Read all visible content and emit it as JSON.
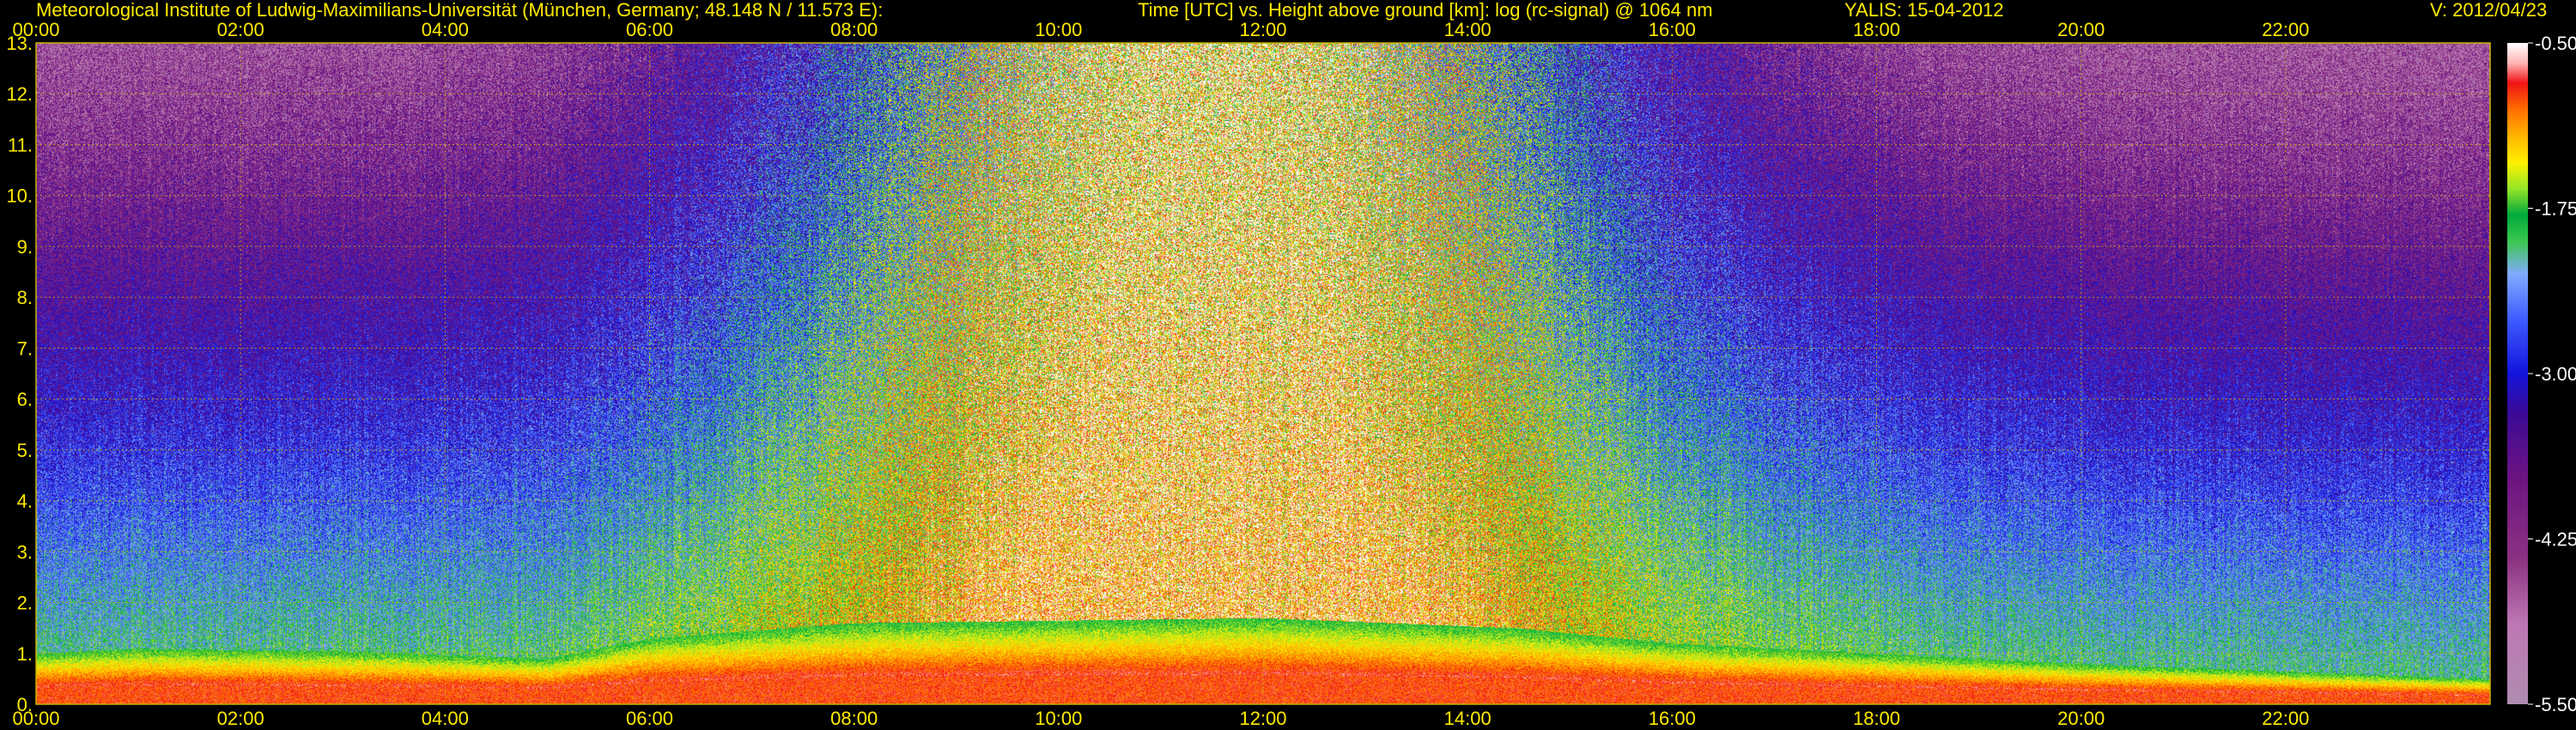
{
  "header": {
    "left": "Meteorological Institute of Ludwig-Maximilians-Universität (München, Germany; 48.148 N / 11.573 E):",
    "center": "Time [UTC] vs. Height above ground [km]: log (rc-signal) @ 1064 nm",
    "station": "YALIS: 15-04-2012",
    "version": "V: 2012/04/23"
  },
  "chart_data": {
    "type": "heatmap",
    "title": "Time [UTC] vs. Height above ground [km]: log (rc-signal) @ 1064 nm",
    "xlabel": "Time [UTC]",
    "ylabel": "Height above ground [km]",
    "x_ticks": [
      "00:00",
      "02:00",
      "04:00",
      "06:00",
      "08:00",
      "10:00",
      "12:00",
      "14:00",
      "16:00",
      "18:00",
      "20:00",
      "22:00"
    ],
    "x_tick_hours": [
      0,
      2,
      4,
      6,
      8,
      10,
      12,
      14,
      16,
      18,
      20,
      22
    ],
    "xlim": [
      0,
      24
    ],
    "y_ticks": [
      "0.",
      "1.",
      "2.",
      "3.",
      "4.",
      "5.",
      "6.",
      "7.",
      "8.",
      "9.",
      "10.",
      "11.",
      "12.",
      "13."
    ],
    "y_tick_values": [
      0,
      1,
      2,
      3,
      4,
      5,
      6,
      7,
      8,
      9,
      10,
      11,
      12,
      13
    ],
    "ylim": [
      0,
      13
    ],
    "grid": true,
    "colorbar": {
      "ticks": [
        "-0.50",
        "-1.75",
        "-3.00",
        "-4.25",
        "-5.50"
      ],
      "values": [
        -0.5,
        -1.75,
        -3.0,
        -4.25,
        -5.5
      ],
      "range": [
        -5.5,
        -0.5
      ]
    },
    "colors": {
      "background": "#000000",
      "text": "#ffea00",
      "grid": "#c8b400",
      "colorbar_text": "#ffffff"
    },
    "boundary_layer_top_km": [
      {
        "hour": 0,
        "value": 1.0
      },
      {
        "hour": 1,
        "value": 1.1
      },
      {
        "hour": 3,
        "value": 1.05
      },
      {
        "hour": 5,
        "value": 0.9
      },
      {
        "hour": 6,
        "value": 1.3
      },
      {
        "hour": 8,
        "value": 1.6
      },
      {
        "hour": 12,
        "value": 1.7
      },
      {
        "hour": 14.5,
        "value": 1.5
      },
      {
        "hour": 16,
        "value": 1.2
      },
      {
        "hour": 18,
        "value": 1.0
      },
      {
        "hour": 20,
        "value": 0.8
      },
      {
        "hour": 24,
        "value": 0.5
      }
    ]
  }
}
